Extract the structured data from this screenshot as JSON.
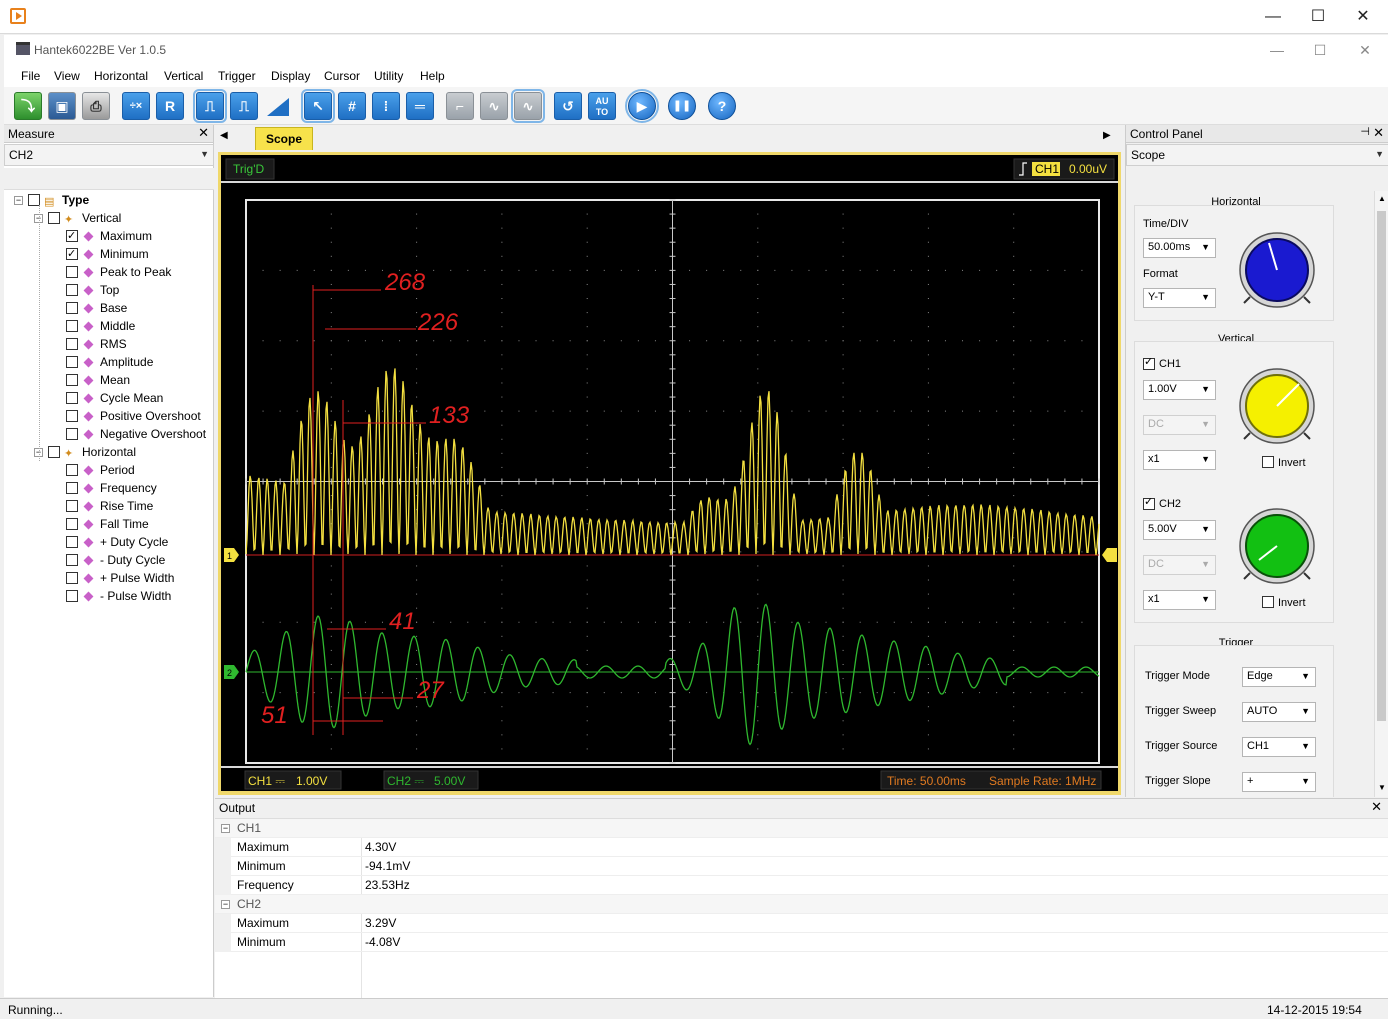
{
  "window": {
    "outer_buttons": [
      "—",
      "☐",
      "✕"
    ],
    "app_title": "Hantek6022BE Ver 1.0.5",
    "app_buttons": [
      "—",
      "☐",
      "✕"
    ]
  },
  "menu": [
    "File",
    "View",
    "Horizontal",
    "Vertical",
    "Trigger",
    "Display",
    "Cursor",
    "Utility",
    "Help"
  ],
  "toolbar": {
    "r_label": "R",
    "auto_label": "AU TO",
    "help_label": "?"
  },
  "measure": {
    "header": "Measure",
    "close": "✕",
    "channel": "CH2",
    "tree": {
      "root": "Type",
      "vertical_label": "Vertical",
      "vertical": [
        {
          "label": "Maximum",
          "checked": true
        },
        {
          "label": "Minimum",
          "checked": true
        },
        {
          "label": "Peak to Peak",
          "checked": false
        },
        {
          "label": "Top",
          "checked": false
        },
        {
          "label": "Base",
          "checked": false
        },
        {
          "label": "Middle",
          "checked": false
        },
        {
          "label": "RMS",
          "checked": false
        },
        {
          "label": "Amplitude",
          "checked": false
        },
        {
          "label": "Mean",
          "checked": false
        },
        {
          "label": "Cycle Mean",
          "checked": false
        },
        {
          "label": "Positive Overshoot",
          "checked": false
        },
        {
          "label": "Negative Overshoot",
          "checked": false
        }
      ],
      "horizontal_label": "Horizontal",
      "horizontal": [
        {
          "label": "Period",
          "checked": false
        },
        {
          "label": "Frequency",
          "checked": false
        },
        {
          "label": "Rise Time",
          "checked": false
        },
        {
          "label": "Fall Time",
          "checked": false
        },
        {
          "label": "+ Duty Cycle",
          "checked": false
        },
        {
          "label": "- Duty Cycle",
          "checked": false
        },
        {
          "label": "+ Pulse Width",
          "checked": false
        },
        {
          "label": "- Pulse Width",
          "checked": false
        }
      ]
    }
  },
  "scope": {
    "tab_label": "Scope",
    "left_arrow": "◀",
    "right_arrow": "▶",
    "trig_status": "Trig'D",
    "trig_channel": "CH1",
    "trig_level": "0.00uV",
    "ch1_marker": "1",
    "ch2_marker": "2",
    "ch1_info": "CH1 ⎓",
    "ch1_scale": "1.00V",
    "ch2_info": "CH2 ⎓",
    "ch2_scale": "5.00V",
    "time_info": "Time: 50.00ms",
    "sample_rate": "Sample Rate: 1MHz",
    "annotations": [
      "268",
      "226",
      "133",
      "41",
      "27",
      "51"
    ],
    "colors": {
      "ch1": "#f4e040",
      "ch2": "#2fb82f",
      "annot": "#e02020",
      "grid": "#c8c8c8"
    }
  },
  "control": {
    "header": "Control Panel",
    "close": "✕",
    "pin": "⊣",
    "mode": "Scope",
    "horizontal": {
      "title": "Horizontal",
      "time_div_label": "Time/DIV",
      "time_div": "50.00ms",
      "format_label": "Format",
      "format": "Y-T"
    },
    "vertical": {
      "title": "Vertical",
      "ch1_label": "CH1",
      "ch1_volts": "1.00V",
      "ch1_coupling": "DC",
      "ch1_probe": "x1",
      "ch1_invert": "Invert",
      "ch2_label": "CH2",
      "ch2_volts": "5.00V",
      "ch2_coupling": "DC",
      "ch2_probe": "x1",
      "ch2_invert": "Invert"
    },
    "trigger": {
      "title": "Trigger",
      "mode_label": "Trigger Mode",
      "mode": "Edge",
      "sweep_label": "Trigger Sweep",
      "sweep": "AUTO",
      "source_label": "Trigger Source",
      "source": "CH1",
      "slope_label": "Trigger Slope",
      "slope": "+"
    }
  },
  "output": {
    "header": "Output",
    "close": "✕",
    "groups": [
      {
        "name": "CH1",
        "rows": [
          {
            "label": "Maximum",
            "value": "4.30V"
          },
          {
            "label": "Minimum",
            "value": "-94.1mV"
          },
          {
            "label": "Frequency",
            "value": "23.53Hz"
          }
        ]
      },
      {
        "name": "CH2",
        "rows": [
          {
            "label": "Maximum",
            "value": "3.29V"
          },
          {
            "label": "Minimum",
            "value": "-4.08V"
          }
        ]
      }
    ]
  },
  "status": {
    "left": "Running...",
    "right": "14-12-2015  19:54"
  }
}
